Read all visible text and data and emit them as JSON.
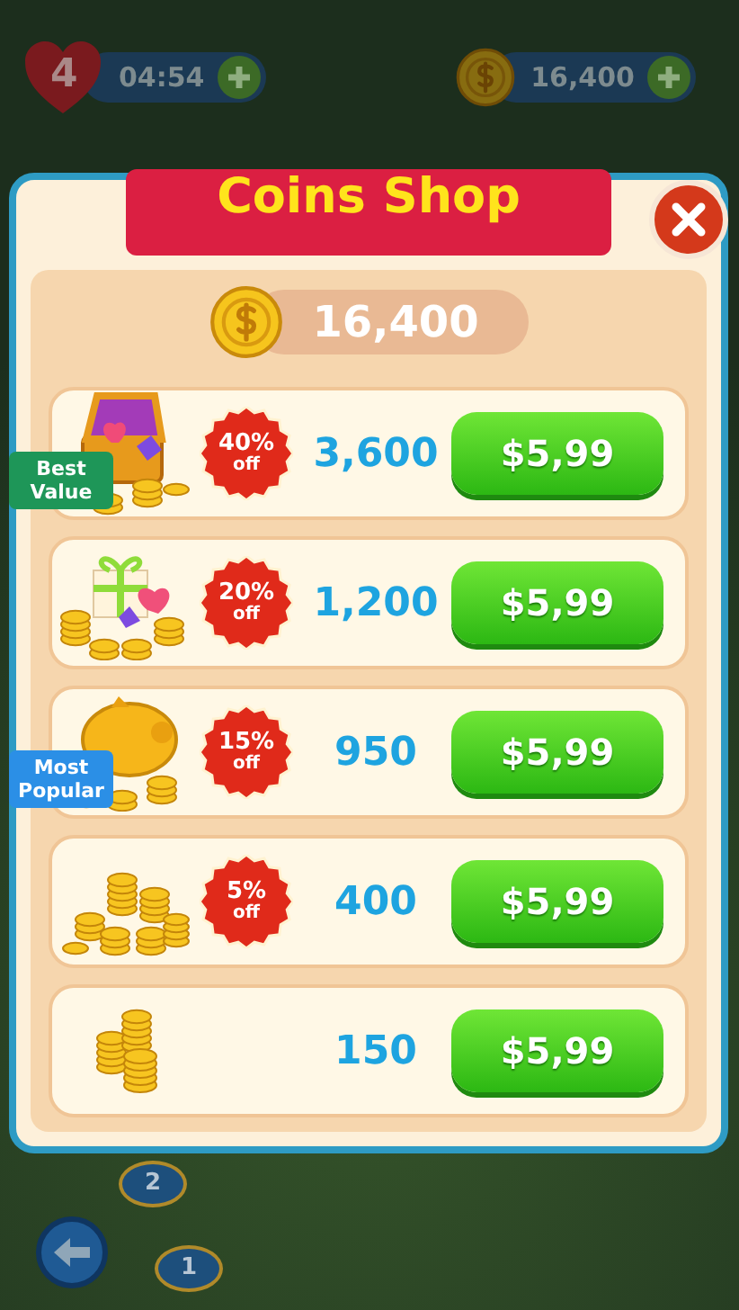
{
  "hud": {
    "lives": "4",
    "timer": "04:54",
    "coins": "16,400"
  },
  "dialog": {
    "title": "Coins Shop",
    "balance": "16,400",
    "offers": [
      {
        "kind": "chest",
        "tag": {
          "text": "Best Value",
          "color": "#1e9658"
        },
        "discount": {
          "percent": "40%",
          "label": "off"
        },
        "amount": "3,600",
        "price": "$5,99"
      },
      {
        "kind": "gift",
        "discount": {
          "percent": "20%",
          "label": "off"
        },
        "amount": "1,200",
        "price": "$5,99"
      },
      {
        "kind": "piggy",
        "tag": {
          "text": "Most Popular",
          "color": "#2b8fe6"
        },
        "discount": {
          "percent": "15%",
          "label": "off"
        },
        "amount": "950",
        "price": "$5,99"
      },
      {
        "kind": "coins-large",
        "discount": {
          "percent": "5%",
          "label": "off"
        },
        "amount": "400",
        "price": "$5,99"
      },
      {
        "kind": "coins-small",
        "amount": "150",
        "price": "$5,99"
      }
    ]
  },
  "map": {
    "levels": [
      "2",
      "1"
    ]
  }
}
